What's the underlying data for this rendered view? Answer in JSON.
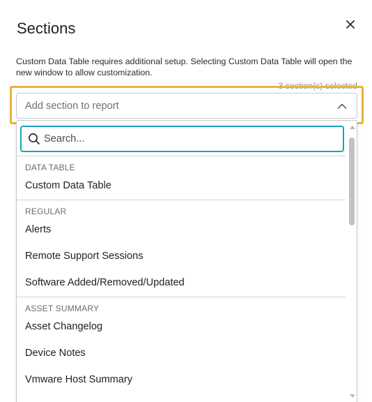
{
  "modal": {
    "title": "Sections",
    "info": "Custom Data Table requires additional setup. Selecting Custom Data Table will open the new window to allow customization.",
    "selected_count": "3 section(s) selected"
  },
  "select": {
    "placeholder": "Add section to report"
  },
  "search": {
    "placeholder": "Search..."
  },
  "groups": {
    "data_table": {
      "label": "DATA TABLE",
      "items": [
        "Custom Data Table"
      ]
    },
    "regular": {
      "label": "REGULAR",
      "items": [
        "Alerts",
        "Remote Support Sessions",
        "Software Added/Removed/Updated"
      ]
    },
    "asset_summary": {
      "label": "ASSET SUMMARY",
      "items": [
        "Asset Changelog",
        "Device Notes",
        "Vmware Host Summary"
      ]
    }
  },
  "colors": {
    "highlight": "#e7b43a",
    "focus": "#1ba3b8",
    "backdrop": "#7e7e7e"
  },
  "icons": {
    "close": "close-icon",
    "chevron": "chevron-up-icon",
    "search": "search-icon"
  }
}
